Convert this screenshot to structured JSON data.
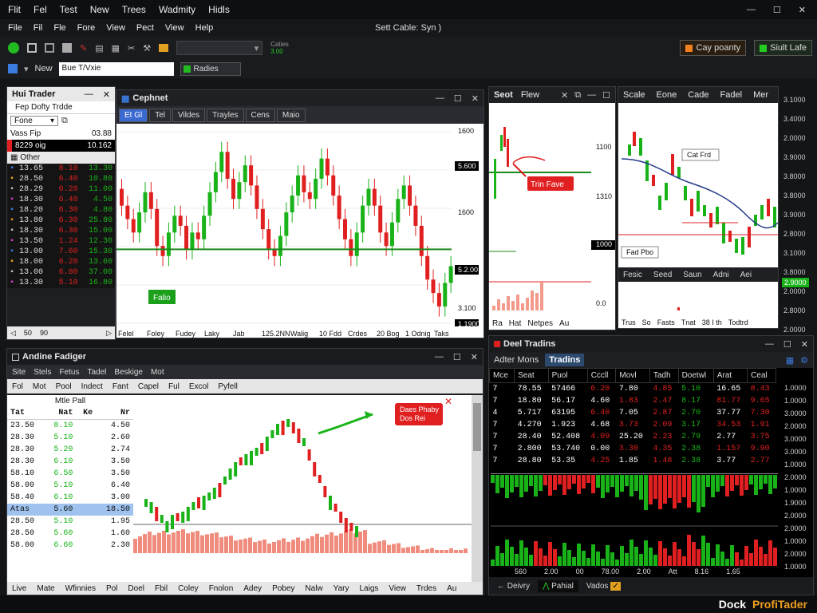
{
  "titlebar": {
    "menus": [
      "Flit",
      "Fel",
      "Test",
      "New",
      "Trees",
      "Wadmity",
      "Hidls"
    ],
    "ctrls": [
      "—",
      "☐",
      "✕"
    ]
  },
  "menubar": {
    "items": [
      "File",
      "Fil",
      "Fle",
      "Fore",
      "View",
      "Pect",
      "View",
      "Help"
    ],
    "center": "Sett Cable: Syn )"
  },
  "toolbar": {
    "combo": "",
    "tip_line1": "Caties",
    "tip_line2": "3.00",
    "right_btn1": "Cay poanty",
    "right_btn2": "Siult Lafe"
  },
  "toolbar2": {
    "new": "New",
    "input": "Bue T/Vxie",
    "dd": "Radies"
  },
  "left_trader": {
    "title": "Hui Trader",
    "sub": "Fep Dofty Trdde",
    "sel": "Fone",
    "rows_head": [
      [
        "Vass Fip",
        "03.88"
      ],
      [
        "8229 oig",
        "10.162"
      ]
    ],
    "section": "Other",
    "rows": [
      [
        "13.65",
        "8.10",
        "13.30"
      ],
      [
        "28.50",
        "6.40",
        "10.80"
      ],
      [
        "28.29",
        "6.20",
        "11.00"
      ],
      [
        "18.30",
        "6.40",
        "4.50"
      ],
      [
        "18.20",
        "6.30",
        "4.80"
      ],
      [
        "13.80",
        "6.30",
        "25.80"
      ],
      [
        "18.30",
        "6.30",
        "15.00"
      ],
      [
        "13.50",
        "1.24",
        "12.30"
      ],
      [
        "13.00",
        "7.60",
        "15.30"
      ],
      [
        "18.00",
        "6.20",
        "13.60"
      ],
      [
        "13.00",
        "6.80",
        "37.00"
      ],
      [
        "13.30",
        "5.10",
        "16.80"
      ]
    ],
    "foot": [
      "50",
      "90",
      ""
    ]
  },
  "chart1": {
    "title": "Cephnet",
    "tabs": [
      "Et Gl",
      "Tel",
      "Vildes",
      "Trayles",
      "Cens",
      "Maio"
    ],
    "axis_y": [
      "1600",
      "5.600",
      "1600",
      "5.2.00",
      "3.100",
      "1.1900"
    ],
    "axis_x": [
      "Felel",
      "Foley",
      "Fudey",
      "Laky",
      "Jab",
      "125.2NN",
      "Walig",
      "10 Fdd",
      "Crdes",
      "20 Bog",
      "1 Odnig",
      "Taks"
    ],
    "badge": "Falio"
  },
  "chart_data": {
    "type": "candlestick",
    "ohlc": [
      [
        1.75,
        1.7
      ],
      [
        1.7,
        1.66
      ],
      [
        1.66,
        1.62
      ],
      [
        1.62,
        1.68
      ],
      [
        1.68,
        1.74
      ],
      [
        1.74,
        1.69
      ],
      [
        1.69,
        1.58
      ],
      [
        1.58,
        1.55
      ],
      [
        1.55,
        1.62
      ],
      [
        1.62,
        1.67
      ],
      [
        1.67,
        1.64
      ],
      [
        1.64,
        1.57
      ],
      [
        1.57,
        1.62
      ],
      [
        1.62,
        1.6
      ],
      [
        1.6,
        1.67
      ],
      [
        1.67,
        1.74
      ],
      [
        1.74,
        1.8
      ],
      [
        1.8,
        1.86
      ],
      [
        1.86,
        1.78
      ],
      [
        1.78,
        1.72
      ],
      [
        1.72,
        1.77
      ],
      [
        1.77,
        1.82
      ],
      [
        1.82,
        1.76
      ],
      [
        1.76,
        1.69
      ],
      [
        1.69,
        1.63
      ],
      [
        1.63,
        1.57
      ],
      [
        1.57,
        1.55
      ],
      [
        1.55,
        1.61
      ],
      [
        1.61,
        1.68
      ],
      [
        1.68,
        1.73
      ],
      [
        1.73,
        1.79
      ],
      [
        1.79,
        1.74
      ],
      [
        1.74,
        1.72
      ],
      [
        1.72,
        1.78
      ],
      [
        1.78,
        1.84
      ],
      [
        1.84,
        1.79
      ],
      [
        1.79,
        1.73
      ],
      [
        1.73,
        1.66
      ],
      [
        1.66,
        1.6
      ],
      [
        1.6,
        1.55
      ],
      [
        1.55,
        1.62
      ],
      [
        1.62,
        1.7
      ],
      [
        1.7,
        1.75
      ],
      [
        1.75,
        1.7
      ],
      [
        1.7,
        1.62
      ],
      [
        1.62,
        1.58
      ],
      [
        1.58,
        1.65
      ],
      [
        1.65,
        1.72
      ],
      [
        1.72,
        1.76
      ],
      [
        1.76,
        1.7
      ],
      [
        1.7,
        1.64
      ],
      [
        1.64,
        1.55
      ],
      [
        1.55,
        1.48
      ],
      [
        1.48,
        1.44
      ],
      [
        1.44,
        1.4
      ],
      [
        1.4,
        1.47
      ],
      [
        1.47,
        1.52
      ]
    ],
    "level": 1.57
  },
  "sv": {
    "tabs": [
      "Seot",
      "Flew"
    ],
    "axis": [
      "1100",
      "1310",
      "1000",
      "0.0"
    ],
    "label": "Trin Fave",
    "foot": [
      "Ra",
      "Hat",
      "Netpes",
      "Au"
    ]
  },
  "rv": {
    "tabs": [
      "Scale",
      "Eone",
      "Cade",
      "Fadel",
      "Mer"
    ],
    "lab1": "Cat Frd",
    "lab2": "Fad Pbo",
    "ticks": [
      "3.1000",
      "3.4000",
      "2.0000",
      "3.9000",
      "3.8000",
      "3.8000",
      "3.9000",
      "2.8000",
      "3.1000",
      "3.8000",
      "2.0000",
      "2.8000",
      "2.0000",
      "1.2000"
    ],
    "badge": "2.9000",
    "foot": [
      "Fesic",
      "Seed",
      "Saun",
      "Adni",
      "Aei"
    ],
    "foot2": [
      "Trus",
      "So",
      "Fasts",
      "Tnat",
      "38 I th",
      "Todtrd"
    ]
  },
  "bl": {
    "title": "Andine Fadiger",
    "menu1": [
      "Site",
      "Stels",
      "Fetus",
      "Tadel",
      "Beskige",
      "Mot"
    ],
    "menu2": [
      "Fol",
      "Mot",
      "Pool",
      "Indect",
      "Fant",
      "Capel",
      "Ful",
      "Excol",
      "Pyfell"
    ],
    "table_title": "Mtle Pall",
    "th": [
      "Tat",
      "Nat",
      "Ke",
      "Nr"
    ],
    "rows": [
      [
        "23.50",
        "8.10",
        "4.50"
      ],
      [
        "28.30",
        "5.10",
        "2.60"
      ],
      [
        "28.30",
        "5.20",
        "2.74"
      ],
      [
        "28.30",
        "6.10",
        "3.50"
      ],
      [
        "58.10",
        "6.50",
        "3.50"
      ],
      [
        "58.00",
        "5.10",
        "6.40"
      ],
      [
        "58.40",
        "6.10",
        "3.00"
      ]
    ],
    "hl": [
      "Atas",
      "5.60",
      "18.50"
    ],
    "rows2": [
      [
        "28.50",
        "5.10",
        "1.95"
      ],
      [
        "28.50",
        "5.60",
        "1.60"
      ],
      [
        "58.00",
        "6.60",
        "2.30"
      ]
    ],
    "tip1": "Daes Phaby",
    "tip2": "Dos Rei",
    "foot": [
      "Live",
      "Mate",
      "Wfinnies",
      "Pol",
      "Doel",
      "Fbil",
      "Coley",
      "Fnolon",
      "Adey",
      "Pobey",
      "Nalw",
      "Yary",
      "Laigs",
      "View",
      "Trdes",
      "Au"
    ]
  },
  "dt": {
    "title": "Deel Tradins",
    "tab1": "Adter Mons",
    "tab2": "Tradins",
    "cols": [
      "Mce",
      "Seat",
      "Puol",
      "Cccll",
      "Movl",
      "Tadh",
      "Doetwl",
      "Arat",
      "Ceal"
    ],
    "rows": [
      [
        "7",
        "78.55",
        "57466",
        "6.20",
        "7.80",
        "4.85",
        "5.10",
        "16.65",
        "8.43"
      ],
      [
        "7",
        "18.80",
        "56.17",
        "4.60",
        "1.83",
        "2.47",
        "8.17",
        "81.77",
        "9.65"
      ],
      [
        "4",
        "5.717",
        "63195",
        "6.40",
        "7.05",
        "2.87",
        "2.70",
        "37.77",
        "7.30"
      ],
      [
        "7",
        "4.270",
        "1.923",
        "4.68",
        "3.73",
        "2.09",
        "3.17",
        "34.53",
        "1.91"
      ],
      [
        "7",
        "28.40",
        "52.408",
        "4.09",
        "25.20",
        "2.23",
        "2.79",
        "2.77",
        "3.75"
      ],
      [
        "7",
        "2.800",
        "53.740",
        "0.00",
        "3.30",
        "4.35",
        "2.38",
        "1.157",
        "9.90"
      ],
      [
        "7",
        "28.80",
        "53.35",
        "4.25",
        "1.85",
        "1.48",
        "2.38",
        "3.77",
        "2.77"
      ]
    ],
    "axis": [
      "1.0000",
      "1.0000",
      "3.0000",
      "2.0000",
      "3.0000",
      "3.0000",
      "1.0000",
      "2.0000",
      "1.0000",
      "1.9000",
      "2.0000",
      "2.0000",
      "1.0000",
      "2.0000",
      "1.0000"
    ],
    "xfoot": [
      "560",
      "2.00",
      "00",
      "78.00",
      "2.00",
      "Att",
      "8.16",
      "1.65"
    ],
    "bottom_tabs": [
      "Deivry",
      "Pahial",
      "Vados"
    ]
  },
  "status": {
    "left": "Dock",
    "right": "ProfiTader"
  },
  "colors": {
    "up": "#19b319",
    "down": "#e02020",
    "accent": "#f0a020"
  }
}
